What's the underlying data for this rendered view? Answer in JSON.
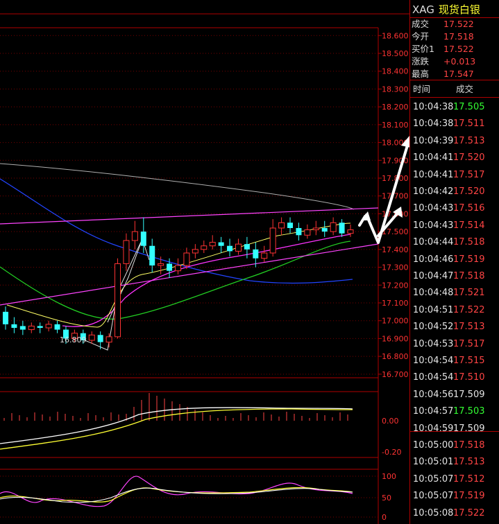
{
  "quote": {
    "symbol": "XAG",
    "name": "现货白银",
    "rows": [
      {
        "label": "成交",
        "value": "17.522"
      },
      {
        "label": "今开",
        "value": "17.518"
      },
      {
        "label": "买价1",
        "value": "17.522"
      },
      {
        "label": "涨跌",
        "value": "+0.013"
      },
      {
        "label": "最高",
        "value": "17.547"
      }
    ]
  },
  "ticks": {
    "header_time": "时间",
    "header_price": "成交",
    "rows": [
      {
        "time": "10:04:38",
        "price": "17.505",
        "color": "#33ff33"
      },
      {
        "time": "10:04:38",
        "price": "17.511",
        "color": "#ff4444"
      },
      {
        "time": "10:04:39",
        "price": "17.513",
        "color": "#ff4444"
      },
      {
        "time": "10:04:41",
        "price": "17.520",
        "color": "#ff4444"
      },
      {
        "time": "10:04:41",
        "price": "17.517",
        "color": "#ff4444"
      },
      {
        "time": "10:04:42",
        "price": "17.520",
        "color": "#ff4444"
      },
      {
        "time": "10:04:43",
        "price": "17.516",
        "color": "#ff4444"
      },
      {
        "time": "10:04:43",
        "price": "17.514",
        "color": "#ff4444"
      },
      {
        "time": "10:04:44",
        "price": "17.518",
        "color": "#ff4444"
      },
      {
        "time": "10:04:46",
        "price": "17.519",
        "color": "#ff4444"
      },
      {
        "time": "10:04:47",
        "price": "17.518",
        "color": "#ff4444"
      },
      {
        "time": "10:04:48",
        "price": "17.521",
        "color": "#ff4444"
      },
      {
        "time": "10:04:51",
        "price": "17.522",
        "color": "#ff4444"
      },
      {
        "time": "10:04:52",
        "price": "17.513",
        "color": "#ff4444"
      },
      {
        "time": "10:04:53",
        "price": "17.517",
        "color": "#ff4444"
      },
      {
        "time": "10:04:54",
        "price": "17.515",
        "color": "#ff4444"
      },
      {
        "time": "10:04:54",
        "price": "17.510",
        "color": "#ff4444"
      },
      {
        "time": "10:04:56",
        "price": "17.509",
        "color": "#e6e6e6"
      },
      {
        "time": "10:04:57",
        "price": "17.503",
        "color": "#33ff33"
      },
      {
        "time": "10:04:59",
        "price": "17.509",
        "color": "#e6e6e6"
      },
      {
        "time": "10:05:00",
        "price": "17.518",
        "color": "#ff4444"
      },
      {
        "time": "10:05:01",
        "price": "17.513",
        "color": "#ff4444"
      },
      {
        "time": "10:05:07",
        "price": "17.512",
        "color": "#ff4444"
      },
      {
        "time": "10:05:07",
        "price": "17.519",
        "color": "#ff4444"
      },
      {
        "time": "10:05:08",
        "price": "17.522",
        "color": "#ff4444"
      }
    ]
  },
  "price_axis": {
    "labels": [
      "18.600",
      "18.500",
      "18.400",
      "18.300",
      "18.200",
      "18.100",
      "18.000",
      "17.900",
      "17.800",
      "17.700",
      "17.600",
      "17.500",
      "17.400",
      "17.300",
      "17.200",
      "17.100",
      "17.000",
      "16.900",
      "16.800",
      "16.700"
    ],
    "low_label": "16.809"
  },
  "macd_axis": {
    "labels": [
      "0.00",
      "-0.20"
    ]
  },
  "kdj_axis": {
    "labels": [
      "100",
      "50",
      "0"
    ]
  },
  "chart_data": {
    "type": "candlestick",
    "ylim": [
      16.68,
      18.64
    ],
    "low_marker": 16.809,
    "candles": [
      {
        "o": 17.05,
        "c": 16.98,
        "h": 17.08,
        "l": 16.95
      },
      {
        "o": 16.98,
        "c": 16.96,
        "h": 17.02,
        "l": 16.93
      },
      {
        "o": 16.97,
        "c": 16.95,
        "h": 17.0,
        "l": 16.92
      },
      {
        "o": 16.95,
        "c": 16.97,
        "h": 16.99,
        "l": 16.93
      },
      {
        "o": 16.97,
        "c": 16.96,
        "h": 16.99,
        "l": 16.93
      },
      {
        "o": 16.96,
        "c": 16.98,
        "h": 17.0,
        "l": 16.94
      },
      {
        "o": 16.98,
        "c": 16.95,
        "h": 17.0,
        "l": 16.93
      },
      {
        "o": 16.95,
        "c": 16.9,
        "h": 16.97,
        "l": 16.87
      },
      {
        "o": 16.9,
        "c": 16.93,
        "h": 16.95,
        "l": 16.88
      },
      {
        "o": 16.93,
        "c": 16.89,
        "h": 16.95,
        "l": 16.87
      },
      {
        "o": 16.89,
        "c": 16.92,
        "h": 16.94,
        "l": 16.87
      },
      {
        "o": 16.92,
        "c": 16.88,
        "h": 16.94,
        "l": 16.84
      },
      {
        "o": 16.88,
        "c": 16.91,
        "h": 16.93,
        "l": 16.85
      },
      {
        "o": 16.91,
        "c": 17.32,
        "h": 17.35,
        "l": 16.9
      },
      {
        "o": 17.32,
        "c": 17.45,
        "h": 17.49,
        "l": 17.28
      },
      {
        "o": 17.45,
        "c": 17.5,
        "h": 17.56,
        "l": 17.4
      },
      {
        "o": 17.5,
        "c": 17.42,
        "h": 17.58,
        "l": 17.38
      },
      {
        "o": 17.42,
        "c": 17.31,
        "h": 17.46,
        "l": 17.27
      },
      {
        "o": 17.31,
        "c": 17.32,
        "h": 17.36,
        "l": 17.26
      },
      {
        "o": 17.32,
        "c": 17.28,
        "h": 17.35,
        "l": 17.24
      },
      {
        "o": 17.28,
        "c": 17.31,
        "h": 17.35,
        "l": 17.26
      },
      {
        "o": 17.31,
        "c": 17.38,
        "h": 17.41,
        "l": 17.29
      },
      {
        "o": 17.38,
        "c": 17.4,
        "h": 17.43,
        "l": 17.35
      },
      {
        "o": 17.4,
        "c": 17.42,
        "h": 17.45,
        "l": 17.38
      },
      {
        "o": 17.42,
        "c": 17.44,
        "h": 17.48,
        "l": 17.4
      },
      {
        "o": 17.44,
        "c": 17.42,
        "h": 17.47,
        "l": 17.38
      },
      {
        "o": 17.42,
        "c": 17.39,
        "h": 17.46,
        "l": 17.36
      },
      {
        "o": 17.39,
        "c": 17.43,
        "h": 17.46,
        "l": 17.37
      },
      {
        "o": 17.43,
        "c": 17.4,
        "h": 17.47,
        "l": 17.35
      },
      {
        "o": 17.4,
        "c": 17.35,
        "h": 17.44,
        "l": 17.3
      },
      {
        "o": 17.35,
        "c": 17.38,
        "h": 17.42,
        "l": 17.33
      },
      {
        "o": 17.38,
        "c": 17.52,
        "h": 17.57,
        "l": 17.36
      },
      {
        "o": 17.52,
        "c": 17.55,
        "h": 17.58,
        "l": 17.48
      },
      {
        "o": 17.55,
        "c": 17.52,
        "h": 17.58,
        "l": 17.49
      },
      {
        "o": 17.52,
        "c": 17.48,
        "h": 17.55,
        "l": 17.45
      },
      {
        "o": 17.48,
        "c": 17.51,
        "h": 17.54,
        "l": 17.46
      },
      {
        "o": 17.51,
        "c": 17.52,
        "h": 17.56,
        "l": 17.48
      },
      {
        "o": 17.52,
        "c": 17.5,
        "h": 17.56,
        "l": 17.47
      },
      {
        "o": 17.5,
        "c": 17.55,
        "h": 17.58,
        "l": 17.48
      },
      {
        "o": 17.55,
        "c": 17.49,
        "h": 17.57,
        "l": 17.47
      },
      {
        "o": 17.49,
        "c": 17.51,
        "h": 17.54,
        "l": 17.47
      }
    ]
  }
}
